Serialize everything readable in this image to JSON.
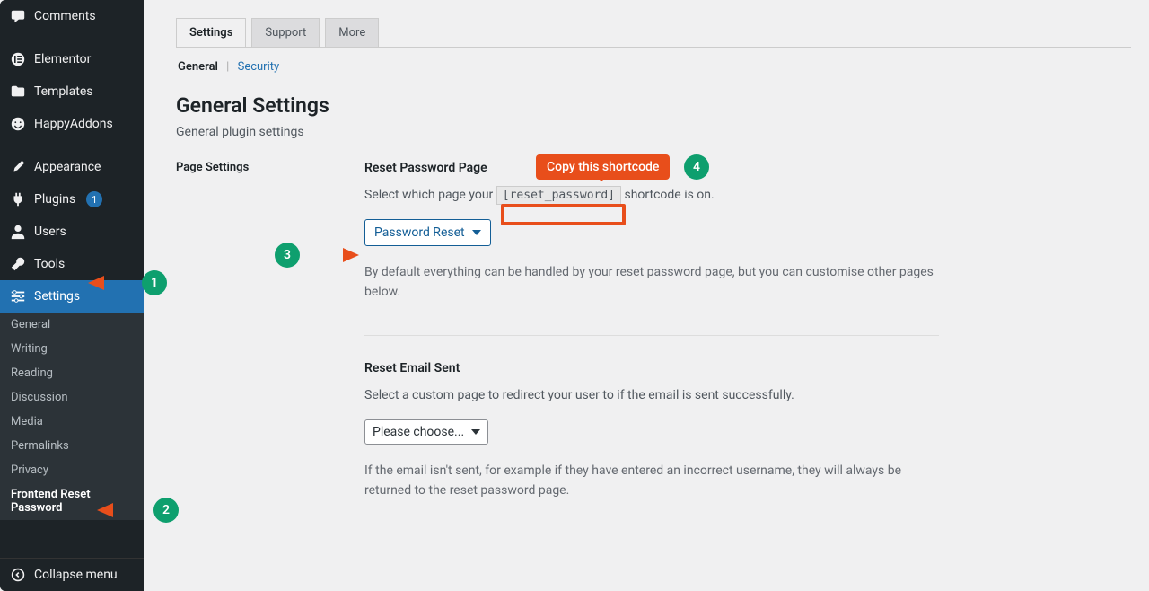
{
  "sidebar": {
    "items": [
      {
        "label": "Comments",
        "icon": "comment"
      },
      {
        "label": "Elementor",
        "icon": "elementor"
      },
      {
        "label": "Templates",
        "icon": "folder"
      },
      {
        "label": "HappyAddons",
        "icon": "happy"
      },
      {
        "label": "Appearance",
        "icon": "brush"
      },
      {
        "label": "Plugins",
        "icon": "plug",
        "badge": "1"
      },
      {
        "label": "Users",
        "icon": "user"
      },
      {
        "label": "Tools",
        "icon": "wrench"
      },
      {
        "label": "Settings",
        "icon": "sliders",
        "active": true
      }
    ],
    "submenu": [
      {
        "label": "General"
      },
      {
        "label": "Writing"
      },
      {
        "label": "Reading"
      },
      {
        "label": "Discussion"
      },
      {
        "label": "Media"
      },
      {
        "label": "Permalinks"
      },
      {
        "label": "Privacy"
      },
      {
        "label": "Frontend Reset Password",
        "active": true
      }
    ],
    "collapse": "Collapse menu"
  },
  "tabs": [
    {
      "label": "Settings",
      "active": true
    },
    {
      "label": "Support"
    },
    {
      "label": "More"
    }
  ],
  "subtabs": {
    "general": "General",
    "security": "Security"
  },
  "header": {
    "title": "General Settings",
    "subtitle": "General plugin settings"
  },
  "page_settings_label": "Page Settings",
  "reset_pw": {
    "title": "Reset Password Page",
    "desc_pre": "Select which page your ",
    "shortcode": "[reset_password]",
    "desc_post": " shortcode is on.",
    "select_value": "Password Reset",
    "note": "By default everything can be handled by your reset password page, but you can customise other pages below."
  },
  "reset_email": {
    "title": "Reset Email Sent",
    "desc": "Select a custom page to redirect your user to if the email is sent successfully.",
    "select_value": "Please choose...",
    "note": "If the email isn't sent, for example if they have entered an incorrect username, they will always be returned to the reset password page."
  },
  "annotations": {
    "1": "1",
    "2": "2",
    "3": "3",
    "4": "4",
    "copy": "Copy this shortcode"
  }
}
